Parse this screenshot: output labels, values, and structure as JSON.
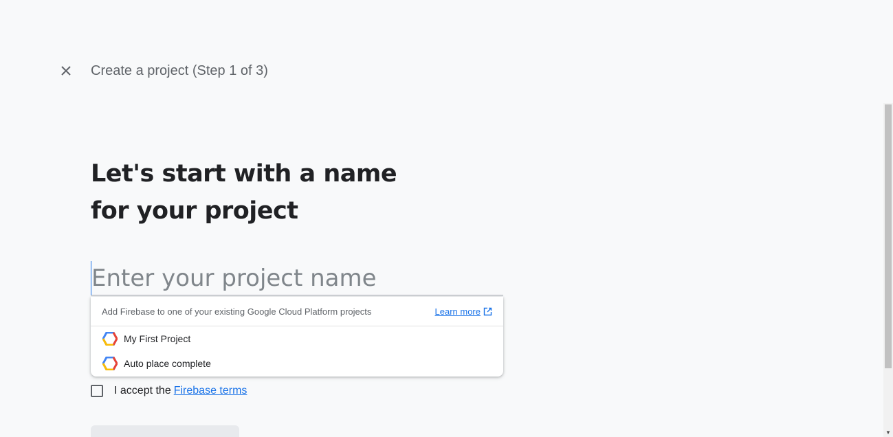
{
  "header": {
    "step_title": "Create a project (Step 1 of 3)"
  },
  "main": {
    "heading": "Let's start with a name for your project",
    "name_input": {
      "placeholder": "Enter your project name",
      "value": ""
    }
  },
  "dropdown": {
    "header_text": "Add Firebase to one of your existing Google Cloud Platform projects",
    "learn_more_label": "Learn more",
    "projects": [
      {
        "name": "My First Project",
        "icon": "gcp-hexagon-icon"
      },
      {
        "name": "Auto place complete",
        "icon": "gcp-hexagon-icon"
      }
    ]
  },
  "terms": {
    "prefix": "I accept the",
    "link_label": "Firebase terms",
    "checked": false
  },
  "colors": {
    "accent": "#1a73e8",
    "background": "#f8f9fa",
    "text": "#202124",
    "muted": "#5f6368"
  }
}
